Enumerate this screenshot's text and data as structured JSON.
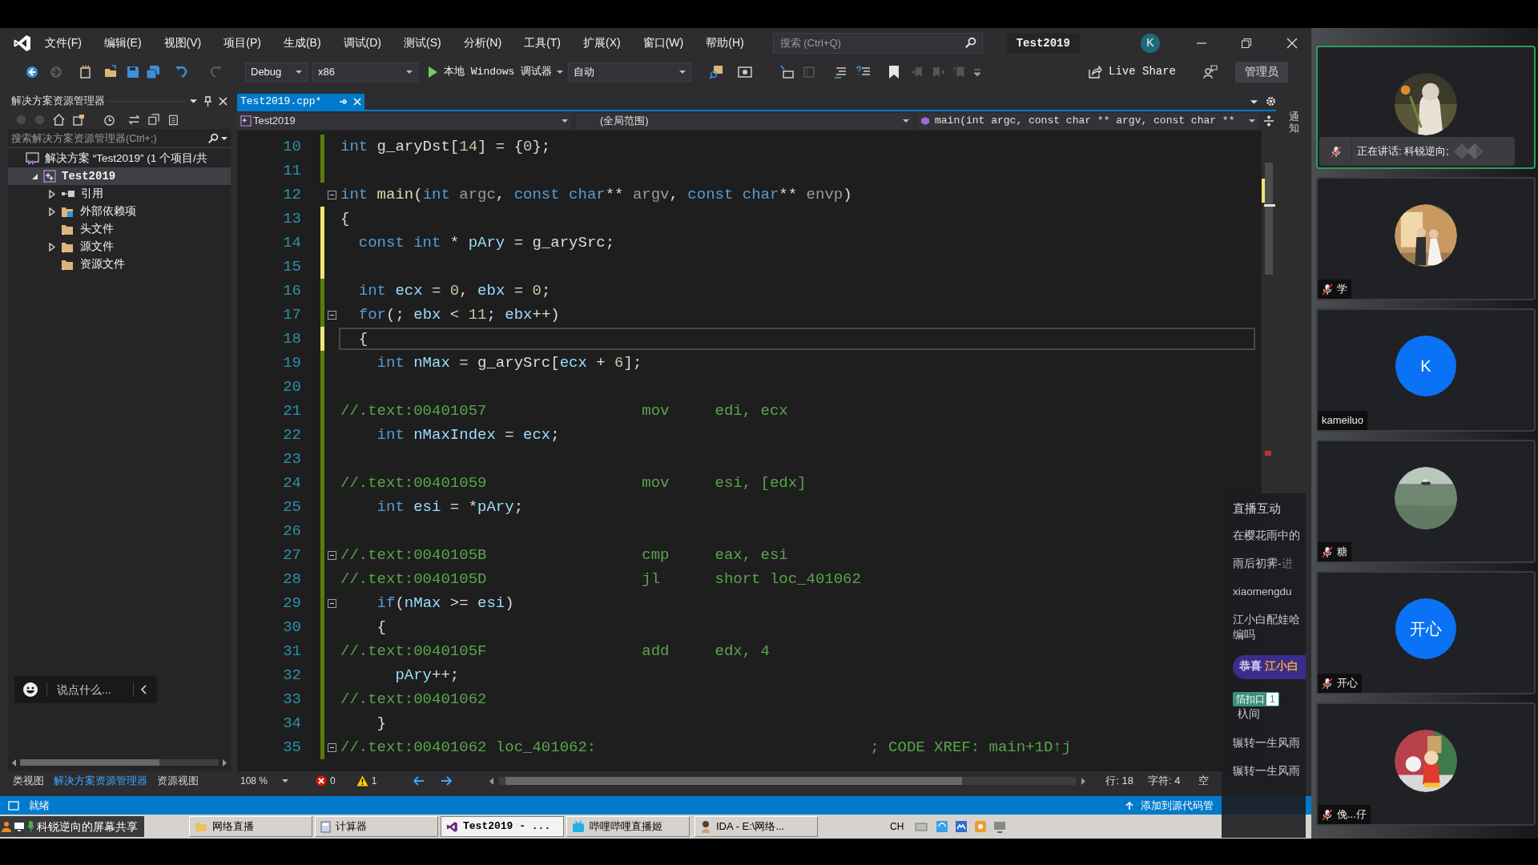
{
  "menu": [
    "文件(F)",
    "编辑(E)",
    "视图(V)",
    "项目(P)",
    "生成(B)",
    "调试(D)",
    "测试(S)",
    "分析(N)",
    "工具(T)",
    "扩展(X)",
    "窗口(W)",
    "帮助(H)"
  ],
  "search": {
    "placeholder": "搜索 (Ctrl+Q)"
  },
  "solution_name": "Test2019",
  "account": {
    "initial": "K"
  },
  "toolbar": {
    "configuration": "Debug",
    "platform": "x86",
    "start": "本地 Windows 调试器",
    "target": "自动",
    "live_share": "Live Share",
    "admin": "管理员"
  },
  "solution_explorer": {
    "title": "解决方案资源管理器",
    "search": {
      "placeholder": "搜索解决方案资源管理器(Ctrl+;)"
    },
    "tree": [
      {
        "label": "解决方案 “Test2019” (1 个项目/共",
        "kind": "solution",
        "selected": false,
        "children": [
          {
            "label": "Test2019",
            "kind": "project",
            "expanded": true,
            "selected": true,
            "children": [
              {
                "label": "引用",
                "kind": "references",
                "expanded": false,
                "selected": false
              },
              {
                "label": "外部依赖项",
                "kind": "external",
                "expanded": false,
                "selected": false
              },
              {
                "label": "头文件",
                "kind": "folder",
                "selected": false
              },
              {
                "label": "源文件",
                "kind": "folder",
                "expanded": false,
                "selected": false
              },
              {
                "label": "资源文件",
                "kind": "folder",
                "selected": false
              }
            ]
          }
        ]
      }
    ]
  },
  "panel_tabs": [
    {
      "label": "类视图",
      "selected": false
    },
    {
      "label": "解决方案资源管理器",
      "selected": true
    },
    {
      "label": "资源视图",
      "selected": false
    }
  ],
  "editor": {
    "tabs": [
      {
        "label": "Test2019.cpp*",
        "selected": true
      }
    ],
    "nav": {
      "project": "Test2019",
      "scope": "(全局范围)",
      "member": "main(int argc, const char ** argv, const char **"
    },
    "lines": [
      {
        "number": "10",
        "color": "#587c0c",
        "collapsible": false,
        "current": false,
        "tokens": [
          {
            "text": "int ",
            "kind": "keyword"
          },
          {
            "text": "g_aryDst[",
            "kind": "plain"
          },
          {
            "text": "14",
            "kind": "number"
          },
          {
            "text": "] = {",
            "kind": "plain"
          },
          {
            "text": "0",
            "kind": "number"
          },
          {
            "text": "};",
            "kind": "plain"
          }
        ]
      },
      {
        "number": "11",
        "color": "#587c0c",
        "collapsible": false,
        "current": false
      },
      {
        "number": "12",
        "collapsible": true,
        "current": false,
        "tokens": [
          {
            "text": "int ",
            "kind": "keyword"
          },
          {
            "text": "main",
            "kind": "function"
          },
          {
            "text": "(",
            "kind": "plain"
          },
          {
            "text": "int ",
            "kind": "keyword"
          },
          {
            "text": "argc",
            "kind": "parameter"
          },
          {
            "text": ", ",
            "kind": "plain"
          },
          {
            "text": "const ",
            "kind": "keyword"
          },
          {
            "text": "char",
            "kind": "keyword"
          },
          {
            "text": "** ",
            "kind": "plain"
          },
          {
            "text": "argv",
            "kind": "parameter"
          },
          {
            "text": ", ",
            "kind": "plain"
          },
          {
            "text": "const ",
            "kind": "keyword"
          },
          {
            "text": "char",
            "kind": "keyword"
          },
          {
            "text": "** ",
            "kind": "plain"
          },
          {
            "text": "envp",
            "kind": "parameter"
          },
          {
            "text": ")",
            "kind": "plain"
          }
        ]
      },
      {
        "number": "13",
        "color": "#efe575",
        "collapsible": false,
        "current": false,
        "tokens": [
          {
            "text": "{",
            "kind": "plain"
          }
        ]
      },
      {
        "number": "14",
        "color": "#efe575",
        "collapsible": false,
        "current": false,
        "tokens": [
          {
            "text": "  const ",
            "kind": "keyword"
          },
          {
            "text": "int",
            "kind": "keyword"
          },
          {
            "text": " * ",
            "kind": "plain"
          },
          {
            "text": "pAry",
            "kind": "local"
          },
          {
            "text": " = g_arySrc;",
            "kind": "plain"
          }
        ]
      },
      {
        "number": "15",
        "color": "#efe575",
        "collapsible": false,
        "current": false
      },
      {
        "number": "16",
        "color": "#587c0c",
        "collapsible": false,
        "current": false,
        "tokens": [
          {
            "text": "  int ",
            "kind": "keyword"
          },
          {
            "text": "ecx",
            "kind": "local"
          },
          {
            "text": " = ",
            "kind": "plain"
          },
          {
            "text": "0",
            "kind": "number"
          },
          {
            "text": ", ",
            "kind": "plain"
          },
          {
            "text": "ebx",
            "kind": "local"
          },
          {
            "text": " = ",
            "kind": "plain"
          },
          {
            "text": "0",
            "kind": "number"
          },
          {
            "text": ";",
            "kind": "plain"
          }
        ]
      },
      {
        "number": "17",
        "color": "#587c0c",
        "collapsible": true,
        "current": false,
        "tokens": [
          {
            "text": "  for",
            "kind": "keyword"
          },
          {
            "text": "(; ",
            "kind": "plain"
          },
          {
            "text": "ebx",
            "kind": "local"
          },
          {
            "text": " < ",
            "kind": "plain"
          },
          {
            "text": "11",
            "kind": "number"
          },
          {
            "text": "; ",
            "kind": "plain"
          },
          {
            "text": "ebx",
            "kind": "local"
          },
          {
            "text": "++)",
            "kind": "plain"
          }
        ]
      },
      {
        "number": "18",
        "color": "#efe575",
        "collapsible": false,
        "current": true,
        "tokens": [
          {
            "text": "  {",
            "kind": "plain"
          }
        ]
      },
      {
        "number": "19",
        "color": "#587c0c",
        "collapsible": false,
        "current": false,
        "tokens": [
          {
            "text": "    int ",
            "kind": "keyword"
          },
          {
            "text": "nMax",
            "kind": "local"
          },
          {
            "text": " = g_arySrc[",
            "kind": "plain"
          },
          {
            "text": "ecx",
            "kind": "local"
          },
          {
            "text": " + ",
            "kind": "plain"
          },
          {
            "text": "6",
            "kind": "number"
          },
          {
            "text": "];",
            "kind": "plain"
          }
        ]
      },
      {
        "number": "20",
        "color": "#587c0c",
        "collapsible": false,
        "current": false
      },
      {
        "number": "21",
        "color": "#587c0c",
        "collapsible": false,
        "current": false,
        "tokens": [
          {
            "text": "//.text:00401057                 mov     edi, ecx",
            "kind": "comment"
          }
        ]
      },
      {
        "number": "22",
        "color": "#587c0c",
        "collapsible": false,
        "current": false,
        "tokens": [
          {
            "text": "    int ",
            "kind": "keyword"
          },
          {
            "text": "nMaxIndex",
            "kind": "local"
          },
          {
            "text": " = ",
            "kind": "plain"
          },
          {
            "text": "ecx",
            "kind": "local"
          },
          {
            "text": ";",
            "kind": "plain"
          }
        ]
      },
      {
        "number": "23",
        "color": "#587c0c",
        "collapsible": false,
        "current": false
      },
      {
        "number": "24",
        "color": "#587c0c",
        "collapsible": false,
        "current": false,
        "tokens": [
          {
            "text": "//.text:00401059                 mov     esi, [edx]",
            "kind": "comment"
          }
        ]
      },
      {
        "number": "25",
        "color": "#587c0c",
        "collapsible": false,
        "current": false,
        "tokens": [
          {
            "text": "    int ",
            "kind": "keyword"
          },
          {
            "text": "esi",
            "kind": "local"
          },
          {
            "text": " = *",
            "kind": "plain"
          },
          {
            "text": "pAry",
            "kind": "local"
          },
          {
            "text": ";",
            "kind": "plain"
          }
        ]
      },
      {
        "number": "26",
        "color": "#587c0c",
        "collapsible": false,
        "current": false
      },
      {
        "number": "27",
        "color": "#587c0c",
        "collapsible": true,
        "current": false,
        "tokens": [
          {
            "text": "//.text:0040105B                 cmp     eax, esi",
            "kind": "comment"
          }
        ]
      },
      {
        "number": "28",
        "color": "#587c0c",
        "collapsible": false,
        "current": false,
        "tokens": [
          {
            "text": "//.text:0040105D                 jl      short loc_401062",
            "kind": "comment"
          }
        ]
      },
      {
        "number": "29",
        "color": "#587c0c",
        "collapsible": true,
        "current": false,
        "tokens": [
          {
            "text": "    if",
            "kind": "keyword"
          },
          {
            "text": "(",
            "kind": "plain"
          },
          {
            "text": "nMax",
            "kind": "local"
          },
          {
            "text": " >= ",
            "kind": "plain"
          },
          {
            "text": "esi",
            "kind": "local"
          },
          {
            "text": ")",
            "kind": "plain"
          }
        ]
      },
      {
        "number": "30",
        "color": "#587c0c",
        "collapsible": false,
        "current": false,
        "tokens": [
          {
            "text": "    {",
            "kind": "plain"
          }
        ]
      },
      {
        "number": "31",
        "color": "#587c0c",
        "collapsible": false,
        "current": false,
        "tokens": [
          {
            "text": "//.text:0040105F                 add     edx, 4",
            "kind": "comment"
          }
        ]
      },
      {
        "number": "32",
        "color": "#587c0c",
        "collapsible": false,
        "current": false,
        "tokens": [
          {
            "text": "      pAry",
            "kind": "local"
          },
          {
            "text": "++;",
            "kind": "plain"
          }
        ]
      },
      {
        "number": "33",
        "color": "#587c0c",
        "collapsible": false,
        "current": false,
        "tokens": [
          {
            "text": "//.text:00401062",
            "kind": "comment"
          }
        ]
      },
      {
        "number": "34",
        "color": "#587c0c",
        "collapsible": false,
        "current": false,
        "tokens": [
          {
            "text": "    }",
            "kind": "plain"
          }
        ]
      },
      {
        "number": "35",
        "color": "#587c0c",
        "collapsible": true,
        "current": false,
        "tokens": [
          {
            "text": "//.text:00401062 loc_401062:                              ; CODE XREF: main+1D↑j",
            "kind": "comment"
          }
        ]
      }
    ],
    "zoom": "108 %",
    "errors": "0",
    "warnings": "1",
    "position": {
      "line": "行: 18",
      "column": "字符: 4",
      "indent": "空"
    }
  },
  "notifications": {
    "label": "通知"
  },
  "status_bar": {
    "text": "就绪",
    "source_control": "添加到源代码管"
  },
  "taskbar": {
    "share": "科锐逆向的屏幕共享",
    "items": [
      {
        "label": "网络直播",
        "selected": false
      },
      {
        "label": "计算器",
        "selected": false
      },
      {
        "label": "Test2019 - ...",
        "selected": true
      },
      {
        "label": "哔哩哔哩直播姬",
        "selected": false
      },
      {
        "label": "IDA - E:\\网络...",
        "selected": false
      }
    ],
    "language": "CH"
  },
  "chat": {
    "title": "直播互动",
    "placeholder": "说点什么...",
    "messages": [
      {
        "kind": "text",
        "name": "在樱花雨中的"
      },
      {
        "kind": "text",
        "name": "雨后初霁-",
        "text": "进"
      },
      {
        "kind": "text",
        "name": "xiaomengdu"
      },
      {
        "kind": "text",
        "name": "江小白配娃哈编吗"
      },
      {
        "kind": "gift",
        "prefix": "恭喜",
        "name": "江小白"
      },
      {
        "kind": "badge",
        "badge": "箔扣口",
        "level": "1",
        "text": "杁间"
      },
      {
        "kind": "text",
        "name": "辗转一生风雨"
      },
      {
        "kind": "text",
        "name": "辗转一生风雨"
      }
    ]
  },
  "participants": [
    {
      "label": "正在讲话: 科锐逆向;",
      "speaking": true,
      "muted": true
    },
    {
      "label": "学",
      "speaking": false,
      "muted": true
    },
    {
      "label": "kameiluo",
      "speaking": false,
      "muted": false,
      "avatar": {
        "kind": "initial",
        "text": "K"
      }
    },
    {
      "label": "糖",
      "speaking": false,
      "muted": true
    },
    {
      "label": "开心",
      "speaking": false,
      "muted": true,
      "avatar": {
        "kind": "initial",
        "text": "开心"
      }
    },
    {
      "label": "俛...仔",
      "speaking": false,
      "muted": true
    }
  ]
}
